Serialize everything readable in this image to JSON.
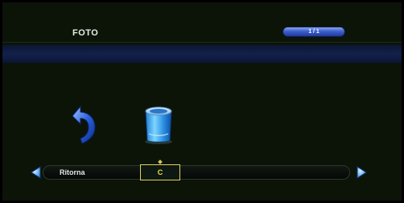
{
  "header": {
    "title": "FOTO",
    "page_indicator": "1 / 1"
  },
  "icons": {
    "back": "back-arrow-icon",
    "trash": "trash-bin-icon"
  },
  "bottom_bar": {
    "back_label": "Ritorna",
    "selected_option": "C"
  },
  "colors": {
    "background": "#0c1408",
    "band": "#13204a",
    "accent": "#3c5fcf",
    "selection": "#f3df3d"
  }
}
